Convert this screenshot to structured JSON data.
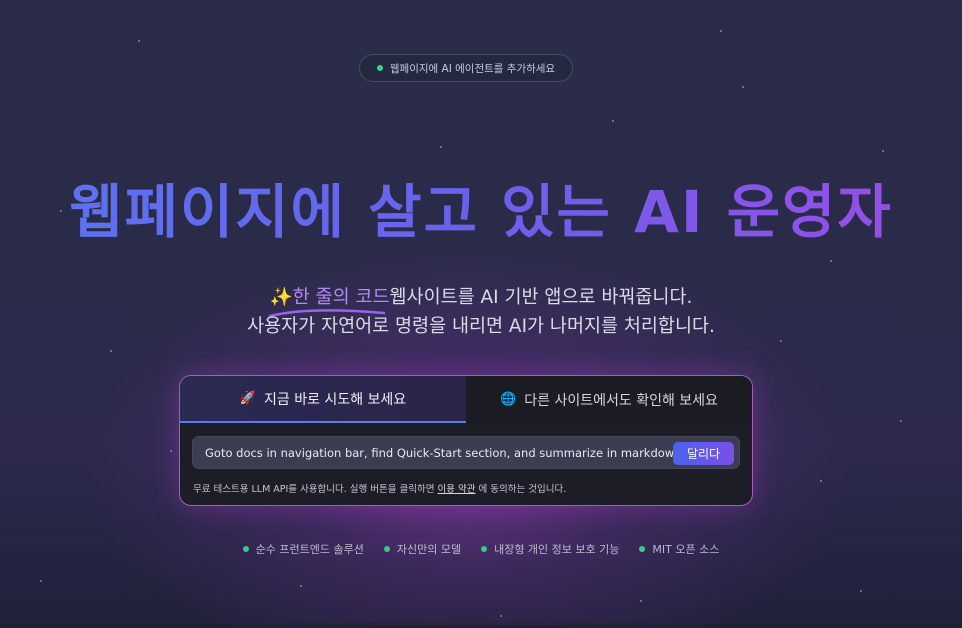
{
  "badge": {
    "label": "웹페이지에 AI 에이전트를 추가하세요"
  },
  "hero": {
    "title": "웹페이지에 살고 있는 AI 운영자"
  },
  "subtitle": {
    "highlight": "✨한 줄의 코드",
    "line1_rest": "웹사이트를 AI 기반 앱으로 바꿔줍니다.",
    "line2": "사용자가 자연어로 명령을 내리면 AI가 나머지를 처리합니다."
  },
  "panel": {
    "tabs": [
      {
        "icon": "🚀",
        "label": "지금 바로 시도해 보세요",
        "active": true
      },
      {
        "icon": "🌐",
        "label": "다른 사이트에서도 확인해 보세요",
        "active": false
      }
    ],
    "input": {
      "value": "Goto docs in navigation bar, find Quick-Start section, and summarize in markdown",
      "placeholder": ""
    },
    "run_button": "달리다",
    "note_prefix": "무료 테스트용 LLM API를 사용합니다. 실행 버튼을 클릭하면 ",
    "note_link": "이용 약관",
    "note_suffix": " 에 동의하는 것입니다."
  },
  "features": [
    "순수 프런트엔드 솔루션",
    "자신만의 모델",
    "내장형 개인 정보 보호 기능",
    "MIT 오픈 소스"
  ],
  "colors": {
    "accent_blue": "#5a74ef",
    "accent_purple": "#9b4ce8",
    "dot_green": "#3ad28a",
    "panel_border": "#c878e6"
  }
}
